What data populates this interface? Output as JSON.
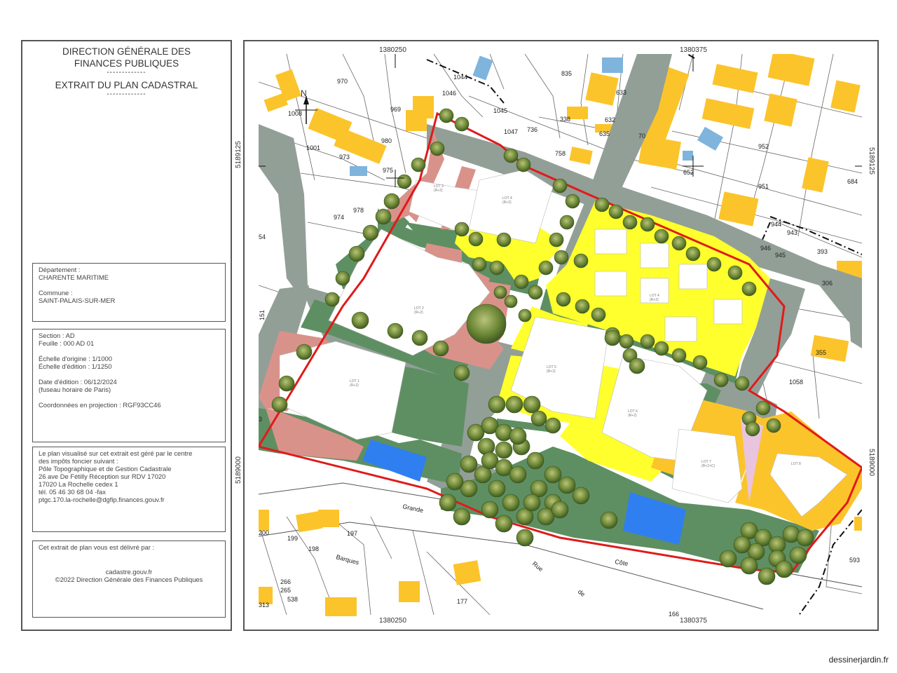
{
  "header": {
    "line1": "DIRECTION GÉNÉRALE DES",
    "line2": "FINANCES PUBLIQUES",
    "sep1": "-------------",
    "line3": "EXTRAIT DU PLAN CADASTRAL",
    "sep2": "-------------"
  },
  "location": {
    "dept_label": "Département :",
    "dept_value": "CHARENTE MARITIME",
    "commune_label": "Commune :",
    "commune_value": "SAINT-PALAIS-SUR-MER"
  },
  "section": {
    "section": "Section : AD",
    "feuille": "Feuille : 000 AD 01",
    "echelle_origine": "Échelle d'origine : 1/1000",
    "echelle_edition": "Échelle d'édition : 1/1250",
    "date_edition": "Date d'édition : 06/12/2024",
    "fuseau": "(fuseau horaire de Paris)",
    "coordonnees": "Coordonnées en projection : RGF93CC46"
  },
  "centre": {
    "l1": "Le plan visualisé sur cet extrait est géré par le centre",
    "l2": "des impôts foncier suivant :",
    "l3": "Pôle Topographique et de Gestion Cadastrale",
    "l4": "26 ave De Fétilly Réception sur RDV 17020",
    "l5": "17020 La Rochelle cedex 1",
    "l6": "tél. 05 46 30 68 04 -fax",
    "l7": "ptgc.170.la-rochelle@dgfip.finances.gouv.fr"
  },
  "delivre": {
    "l1": "Cet extrait de plan vous est délivré par :",
    "l2": "cadastre.gouv.fr",
    "l3": "©2022 Direction Générale des Finances Publiques"
  },
  "coords": {
    "top_left": "1380250",
    "top_right": "1380375",
    "bottom_left": "1380250",
    "bottom_right": "1380375",
    "left_top": "5189125",
    "left_bottom": "5189000",
    "right_top": "5189125",
    "right_bottom": "5189000"
  },
  "north": "N",
  "parcels": [
    "970",
    "1008",
    "969",
    "1001",
    "980",
    "973",
    "975",
    "974",
    "978",
    "1046",
    "1044",
    "1045",
    "1047",
    "758",
    "736",
    "338",
    "635",
    "632",
    "633",
    "835",
    "70",
    "652",
    "952",
    "951",
    "684",
    "943",
    "944",
    "946",
    "945",
    "393",
    "306",
    "355",
    "1058",
    "199",
    "198",
    "197",
    "177",
    "166",
    "265",
    "538",
    "593",
    "266",
    "313",
    "200",
    "54",
    "151",
    "3"
  ],
  "streets": [
    "Grande",
    "Côte",
    "Rue",
    "de",
    "Barques"
  ],
  "lots": [
    {
      "name": "LOT 1",
      "sub": "(R+2)"
    },
    {
      "name": "LOT 2",
      "sub": "(R+2)"
    },
    {
      "name": "LOT 3",
      "sub": "(R+2)"
    },
    {
      "name": "LOT 4",
      "sub": "(R+2)"
    },
    {
      "name": "LOT 4",
      "sub": "(R+2)"
    },
    {
      "name": "LOT 5",
      "sub": "(R+2)"
    },
    {
      "name": "LOT 6",
      "sub": "(R+2)"
    },
    {
      "name": "LOT 7",
      "sub": "(R+2+C)"
    },
    {
      "name": "LOT 8",
      "sub": ""
    }
  ],
  "credit": "dessinerjardin.fr",
  "colors": {
    "green_space": "#5e8f63",
    "path_grey": "#929f97",
    "lot_yellow": "#ffff2e",
    "house_orange": "#fcc42b",
    "pool_blue": "#2f7ff0",
    "boundary_red": "#e01a1a",
    "brick": "#d9928a"
  }
}
